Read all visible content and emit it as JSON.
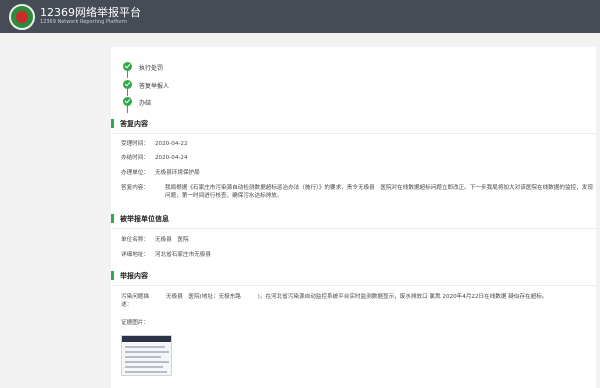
{
  "header": {
    "title": "12369网络举报平台",
    "subtitle": "12369 Network Reporting Platform"
  },
  "steps": [
    {
      "label": "执行处罚"
    },
    {
      "label": "答复举报人"
    },
    {
      "label": "办结"
    }
  ],
  "reply": {
    "section_title": "答复内容",
    "rows": [
      {
        "key": "受理时间：",
        "value": "2020-04-22"
      },
      {
        "key": "办结时间：",
        "value": "2020-04-24"
      },
      {
        "key": "办理单位：",
        "value": "无极县环境保护局"
      }
    ],
    "reply_key": "答复内容：",
    "reply_value": "我局根据《石家庄市污染源自动检测数据超标惩治办法（施行）》的要求，责令无极县　医院对在线数据超标问题立即改正。下一步我局将加大对该医院在线数据的监控，发现问题，第一时间进行核查，确保污水达标排放。"
  },
  "reported": {
    "section_title": "被举报单位信息",
    "rows": [
      {
        "key": "单位名称：",
        "value": "无极县　医院"
      },
      {
        "key": "详细地址：",
        "value": "河北省石家庄市无极县"
      }
    ]
  },
  "report": {
    "section_title": "举报内容",
    "issue_key": "污染问题描述：",
    "issue_value": "无极县　医院(地址：无极东路　　　)，在河北省污染源自动监控系统平台实时监测数据显示，废水排放口 氯氮 2020年4月22日在线数据 疑似存在超标。",
    "evidence_key": "证据图片："
  }
}
